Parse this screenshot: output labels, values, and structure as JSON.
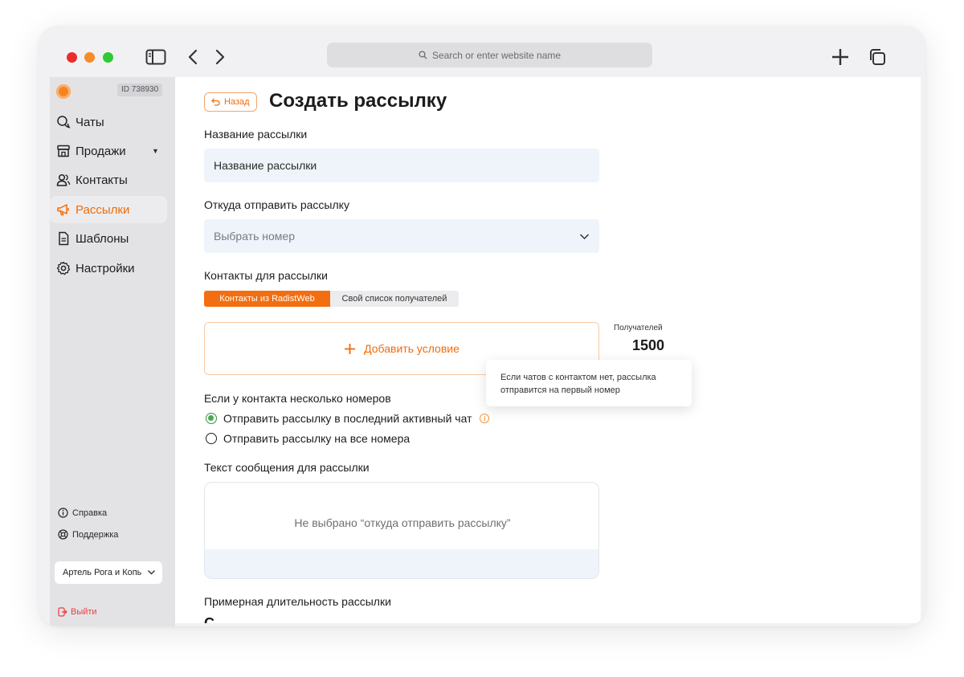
{
  "browser": {
    "address_placeholder": "Search or enter website name"
  },
  "sidebar": {
    "account_id": "ID 738930",
    "nav": [
      {
        "label": "Чаты",
        "icon": "chat-icon"
      },
      {
        "label": "Продажи",
        "icon": "store-icon"
      },
      {
        "label": "Контакты",
        "icon": "contacts-icon"
      },
      {
        "label": "Рассылки",
        "icon": "megaphone-icon",
        "active": true
      },
      {
        "label": "Шаблоны",
        "icon": "document-icon"
      },
      {
        "label": "Настройки",
        "icon": "gear-icon"
      }
    ],
    "help": "Справка",
    "support": "Поддержка",
    "company": "Артель Рога и Копыта",
    "logout": "Выйти"
  },
  "main": {
    "back_label": "Назад",
    "title": "Создать рассылку",
    "name_label": "Название рассылки",
    "name_value": "Название рассылки",
    "from_label": "Откуда отправить рассылку",
    "from_placeholder": "Выбрать номер",
    "contacts_label": "Контакты для рассылки",
    "tab_radist": "Контакты из RadistWeb",
    "tab_own": "Свой список получателей",
    "add_condition": "Добавить условие",
    "recipients_label": "Получателей",
    "recipients_value": "1500",
    "tooltip": "Если чатов с контактом нет, рассылка отправится на первый номер",
    "multi_label": "Если у контакта несколько номеров",
    "radio_last": "Отправить рассылку в последний активный чат",
    "radio_all": "Отправить рассылку на все номера",
    "text_label": "Текст сообщения для рассылки",
    "text_placeholder": "Не выбрано “откуда отправить рассылку”",
    "duration_label": "Примерная длительность рассылки",
    "duration_value_cut": "С"
  },
  "colors": {
    "accent": "#f36e10",
    "radio_checked": "#44ad4f",
    "logout": "#ee3d3d"
  }
}
